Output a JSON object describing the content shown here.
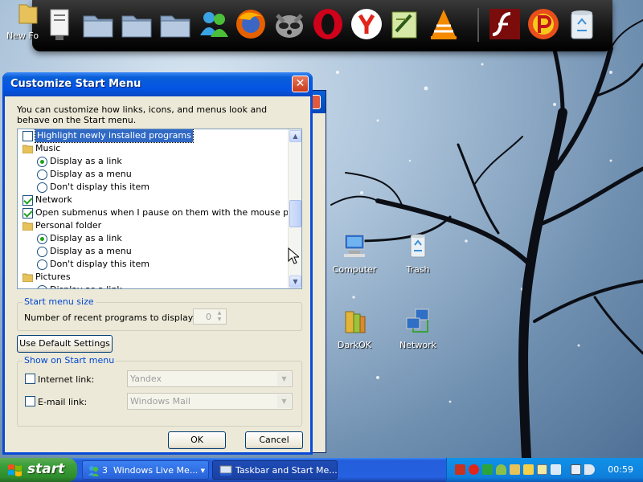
{
  "desktop": {
    "partial_label": "New Fo",
    "icons": [
      {
        "label": "Computer"
      },
      {
        "label": "Trash"
      },
      {
        "label": "DarkOK"
      },
      {
        "label": "Network"
      }
    ],
    "dock_icons": [
      "doc-viewer-icon",
      "folder-icon",
      "folder-icon",
      "folder-icon",
      "messenger-icon",
      "firefox-icon",
      "raccoon-icon",
      "opera-icon",
      "yandex-icon",
      "notepad-icon",
      "vlc-icon",
      "flash-icon",
      "pdf-icon",
      "recycle-bin-icon"
    ]
  },
  "dialog": {
    "title": "Customize Start Menu",
    "close_label": "✕",
    "description": "You can customize how links, icons, and menus look and behave on the Start menu.",
    "list": [
      {
        "type": "checkbox",
        "checked": false,
        "label": "Highlight newly installed programs",
        "selected": true,
        "indent": 0
      },
      {
        "type": "folder",
        "label": "Music",
        "indent": 0
      },
      {
        "type": "radio",
        "checked": true,
        "label": "Display as a link",
        "indent": 1
      },
      {
        "type": "radio",
        "checked": false,
        "label": "Display as a menu",
        "indent": 1
      },
      {
        "type": "radio",
        "checked": false,
        "label": "Don't display this item",
        "indent": 1
      },
      {
        "type": "checkbox",
        "checked": true,
        "label": "Network",
        "indent": 0
      },
      {
        "type": "checkbox",
        "checked": true,
        "label": "Open submenus when I pause on them with the mouse pointer",
        "indent": 0
      },
      {
        "type": "folder",
        "label": "Personal folder",
        "indent": 0
      },
      {
        "type": "radio",
        "checked": true,
        "label": "Display as a link",
        "indent": 1
      },
      {
        "type": "radio",
        "checked": false,
        "label": "Display as a menu",
        "indent": 1
      },
      {
        "type": "radio",
        "checked": false,
        "label": "Don't display this item",
        "indent": 1
      },
      {
        "type": "folder",
        "label": "Pictures",
        "indent": 0
      },
      {
        "type": "radio",
        "checked": true,
        "label": "Display as a link",
        "indent": 1
      }
    ],
    "start_menu_size": {
      "title": "Start menu size",
      "recent_label": "Number of recent programs to display:",
      "recent_value": "0"
    },
    "default_button": "Use Default Settings",
    "show_on_start": {
      "title": "Show on Start menu",
      "internet_label": "Internet link:",
      "internet_value": "Yandex",
      "email_label": "E-mail link:",
      "email_value": "Windows Mail"
    },
    "ok_label": "OK",
    "cancel_label": "Cancel"
  },
  "taskbar": {
    "start_label": "start",
    "tasks": [
      {
        "count": "3",
        "label": "Windows Live Me..."
      },
      {
        "label": "Taskbar and Start Me..."
      }
    ],
    "clock": "00:59"
  }
}
